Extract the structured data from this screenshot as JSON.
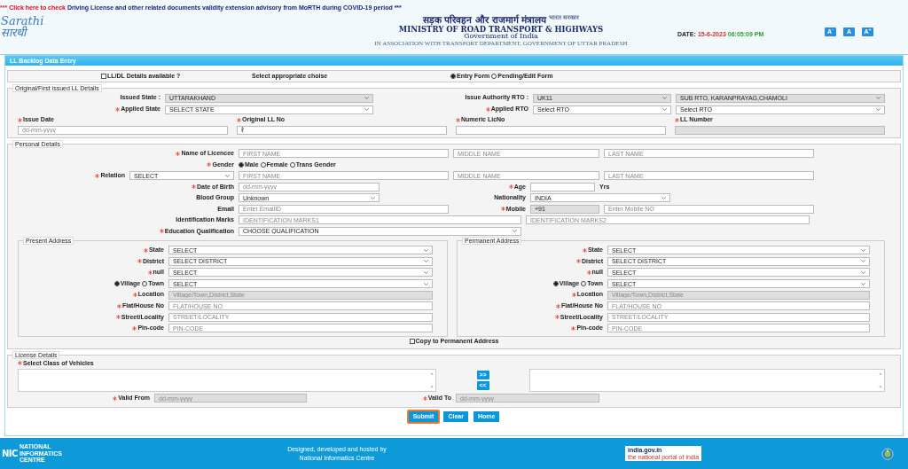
{
  "notice": {
    "lead": "***",
    "link": "Click here to check",
    "text": "Driving License and other related documents validity extension advisory from MoRTH during COVID-19 period ***"
  },
  "logo": {
    "latin": "Sarathi",
    "hindi": "सारथी"
  },
  "ministry": {
    "hindi": "सड़क परिवहन और राजमार्ग मंत्रालय",
    "hindi_tag": "भारत सरकार",
    "english": "MINISTRY OF ROAD TRANSPORT & HIGHWAYS",
    "government": "Government of India",
    "association": "IN ASSOCIATION WITH TRANSPORT DEPARTMENT, GOVERNMENT OF UTTAR PRADESH"
  },
  "datetime": {
    "label": "DATE:",
    "date": "15-6-2023",
    "time": "06:05:09 PM"
  },
  "font_buttons": [
    "A$^{-}$",
    "A",
    "A$^{+}$"
  ],
  "panel_title": "LL Backlog Data Entry",
  "choice_bar": {
    "checkbox": {
      "label": "LL/DL Details available ?",
      "checked": false
    },
    "prompt": "Select appropriate choise",
    "radios": [
      {
        "label": "Entry Form",
        "selected": true
      },
      {
        "label": "Pending/Edit Form",
        "selected": false
      }
    ]
  },
  "ll_details": {
    "legend": "Original/First issued LL Details",
    "lines": [
      {
        "items": [
          {
            "kind": "label",
            "text": "Issued State :",
            "required": false
          },
          {
            "kind": "select",
            "value": "UTTARAKHAND",
            "disabled": true
          },
          {
            "kind": "label",
            "text": "Issue Authority RTO :",
            "required": false
          },
          {
            "kind": "select",
            "value": "UK11",
            "disabled": true
          },
          {
            "kind": "select",
            "value": "SUB RTO, KARANPRAYAG,CHAMOLI",
            "disabled": true
          }
        ]
      },
      {
        "items": [
          {
            "kind": "label",
            "text": "Applied State",
            "required": true
          },
          {
            "kind": "select",
            "value": "SELECT STATE",
            "disabled": false
          },
          {
            "kind": "label",
            "text": "Applied RTO",
            "required": true
          },
          {
            "kind": "select",
            "value": "Select RTO",
            "disabled": false
          },
          {
            "kind": "select",
            "value": "Select RTO",
            "disabled": false
          }
        ]
      },
      {
        "items": [
          {
            "kind": "stacked",
            "label": "Issue Date",
            "required": true,
            "placeholder": "dd-mm-yyyy",
            "disabled": false
          },
          {
            "kind": "stacked",
            "label": "Original LL No",
            "required": true,
            "value": "रे़",
            "disabled": false
          },
          {
            "kind": "stacked",
            "label": "Numeric LicNo",
            "required": true,
            "disabled": false
          },
          {
            "kind": "stacked",
            "label": "LL Number",
            "required": true,
            "disabled": true
          }
        ]
      }
    ]
  },
  "personal": {
    "legend": "Personal Details",
    "lines": [
      {
        "items": [
          {
            "kind": "label",
            "text": "Name of Licencee",
            "required": true
          },
          {
            "kind": "input",
            "placeholder": "FIRST NAME",
            "disabled": false
          },
          {
            "kind": "input",
            "placeholder": "MIDDLE NAME",
            "disabled": false
          },
          {
            "kind": "input",
            "placeholder": "LAST NAME",
            "disabled": false
          }
        ]
      },
      {
        "items": [
          {
            "kind": "label",
            "text": "Gender",
            "required": true
          },
          {
            "kind": "radios",
            "options": [
              {
                "label": "Male",
                "selected": true
              },
              {
                "label": "Female",
                "selected": false
              },
              {
                "label": "Trans Gender",
                "selected": false
              }
            ]
          }
        ]
      },
      {
        "items": [
          {
            "kind": "label",
            "text": "Relation",
            "required": true
          },
          {
            "kind": "select",
            "value": "SELECT",
            "disabled": false
          },
          {
            "kind": "input",
            "placeholder": "FIRST NAME",
            "disabled": false
          },
          {
            "kind": "input",
            "placeholder": "MIDDLE NAME",
            "disabled": false
          },
          {
            "kind": "input",
            "placeholder": "LAST NAME",
            "disabled": false
          }
        ]
      },
      {
        "items": [
          {
            "kind": "label",
            "text": "Date of Birth",
            "required": true
          },
          {
            "kind": "input",
            "placeholder": "dd-mm-yyyy",
            "disabled": false
          },
          {
            "kind": "label",
            "text": "Age",
            "required": true
          },
          {
            "kind": "input",
            "disabled": false
          },
          {
            "kind": "text",
            "text": "Yrs"
          }
        ]
      },
      {
        "items": [
          {
            "kind": "label",
            "text": "Blood Group",
            "required": false
          },
          {
            "kind": "select",
            "value": "Unknown",
            "disabled": false
          },
          {
            "kind": "label",
            "text": "Nationality",
            "required": false
          },
          {
            "kind": "select",
            "value": "INDIA",
            "disabled": false
          }
        ]
      },
      {
        "items": [
          {
            "kind": "label",
            "text": "Email",
            "required": false
          },
          {
            "kind": "input",
            "placeholder": "Enter EmailID",
            "disabled": false
          },
          {
            "kind": "label",
            "text": "Mobile",
            "required": true
          },
          {
            "kind": "input",
            "value": "+91",
            "disabled": true
          },
          {
            "kind": "input",
            "placeholder": "Enter Mobile NO",
            "disabled": false
          }
        ]
      },
      {
        "items": [
          {
            "kind": "label",
            "text": "Identification Marks",
            "required": false
          },
          {
            "kind": "input",
            "placeholder": "IDENTIFICATION MARKS1",
            "disabled": false
          },
          {
            "kind": "input",
            "placeholder": "IDENTIFICATION MARKS2",
            "disabled": false
          }
        ]
      },
      {
        "items": [
          {
            "kind": "label",
            "text": "Education Qualification",
            "required": true
          },
          {
            "kind": "select",
            "value": "CHOOSE QUALIFICATION",
            "disabled": false
          }
        ]
      }
    ],
    "addresses": [
      {
        "legend": "Present Address",
        "lines": [
          {
            "items": [
              {
                "kind": "label",
                "text": "State",
                "required": true
              },
              {
                "kind": "select",
                "value": "SELECT",
                "disabled": false
              }
            ]
          },
          {
            "items": [
              {
                "kind": "label",
                "text": "District",
                "required": true
              },
              {
                "kind": "select",
                "value": "SELECT DISTRICT",
                "disabled": false
              }
            ]
          },
          {
            "items": [
              {
                "kind": "label",
                "text": "null",
                "required": true
              },
              {
                "kind": "select",
                "value": "SELECT",
                "disabled": false
              }
            ]
          },
          {
            "items": [
              {
                "kind": "radios",
                "options": [
                  {
                    "label": "Village",
                    "selected": true
                  },
                  {
                    "label": "Town",
                    "selected": false
                  }
                ]
              },
              {
                "kind": "select",
                "value": "SELECT",
                "disabled": false
              }
            ]
          },
          {
            "items": [
              {
                "kind": "label",
                "text": "Location",
                "required": true
              },
              {
                "kind": "input",
                "placeholder": "Village/Town,District,State",
                "disabled": true
              }
            ]
          },
          {
            "items": [
              {
                "kind": "label",
                "text": "Flat/House No",
                "required": true
              },
              {
                "kind": "input",
                "placeholder": "FLAT/HOUSE NO",
                "disabled": false
              }
            ]
          },
          {
            "items": [
              {
                "kind": "label",
                "text": "Street/Locality",
                "required": true
              },
              {
                "kind": "input",
                "placeholder": "STREET/LOCALITY",
                "disabled": false
              }
            ]
          },
          {
            "items": [
              {
                "kind": "label",
                "text": "Pin-code",
                "required": true
              },
              {
                "kind": "input",
                "placeholder": "PIN-CODE",
                "disabled": false
              }
            ]
          }
        ]
      },
      {
        "legend": "Permanent Address",
        "lines": [
          {
            "items": [
              {
                "kind": "label",
                "text": "State",
                "required": true
              },
              {
                "kind": "select",
                "value": "SELECT",
                "disabled": false
              }
            ]
          },
          {
            "items": [
              {
                "kind": "label",
                "text": "District",
                "required": true
              },
              {
                "kind": "select",
                "value": "SELECT DISTRICT",
                "disabled": false
              }
            ]
          },
          {
            "items": [
              {
                "kind": "label",
                "text": "null",
                "required": true
              },
              {
                "kind": "select",
                "value": "SELECT",
                "disabled": false
              }
            ]
          },
          {
            "items": [
              {
                "kind": "radios",
                "options": [
                  {
                    "label": "Village",
                    "selected": true
                  },
                  {
                    "label": "Town",
                    "selected": false
                  }
                ]
              },
              {
                "kind": "select",
                "value": "SELECT",
                "disabled": false
              }
            ]
          },
          {
            "items": [
              {
                "kind": "label",
                "text": "Location",
                "required": true
              },
              {
                "kind": "input",
                "placeholder": "Village/Town,District,State",
                "disabled": true
              }
            ]
          },
          {
            "items": [
              {
                "kind": "label",
                "text": "Flat/House No",
                "required": true
              },
              {
                "kind": "input",
                "placeholder": "FLAT/HOUSE NO",
                "disabled": false
              }
            ]
          },
          {
            "items": [
              {
                "kind": "label",
                "text": "Street/Locality",
                "required": true
              },
              {
                "kind": "input",
                "placeholder": "STREET/LOCALITY",
                "disabled": false
              }
            ]
          },
          {
            "items": [
              {
                "kind": "label",
                "text": "Pin-code",
                "required": true
              },
              {
                "kind": "input",
                "placeholder": "PIN-CODE",
                "disabled": false
              }
            ]
          }
        ]
      }
    ],
    "copy_checkbox": {
      "label": "Copy to Permanent Address",
      "checked": false
    }
  },
  "license": {
    "legend": "License Details",
    "vehicles_label": {
      "kind": "label",
      "text": "Select Class of Vehicles",
      "required": true
    },
    "move_buttons": [
      ">>",
      "<<"
    ],
    "valid_line": {
      "items": [
        {
          "kind": "label",
          "text": "Valid From",
          "required": true
        },
        {
          "kind": "input",
          "placeholder": "dd-mm-yyyy",
          "disabled": true
        },
        {
          "kind": "label",
          "text": "Valid To",
          "required": true
        },
        {
          "kind": "input",
          "placeholder": "dd-mm-yyyy",
          "disabled": true
        }
      ]
    }
  },
  "buttons": [
    {
      "label": "Submit",
      "focused": true
    },
    {
      "label": "Clear",
      "focused": false
    },
    {
      "label": "Home",
      "focused": false
    }
  ],
  "footer": {
    "nic": {
      "mark": "NIC",
      "name": "NATIONAL INFORMATICS CENTRE"
    },
    "credit": [
      "Designed, developed and hosted by",
      "National Informatics Centre"
    ],
    "portal": {
      "name": "india.gov.in",
      "tagline": "the national portal of india"
    }
  }
}
